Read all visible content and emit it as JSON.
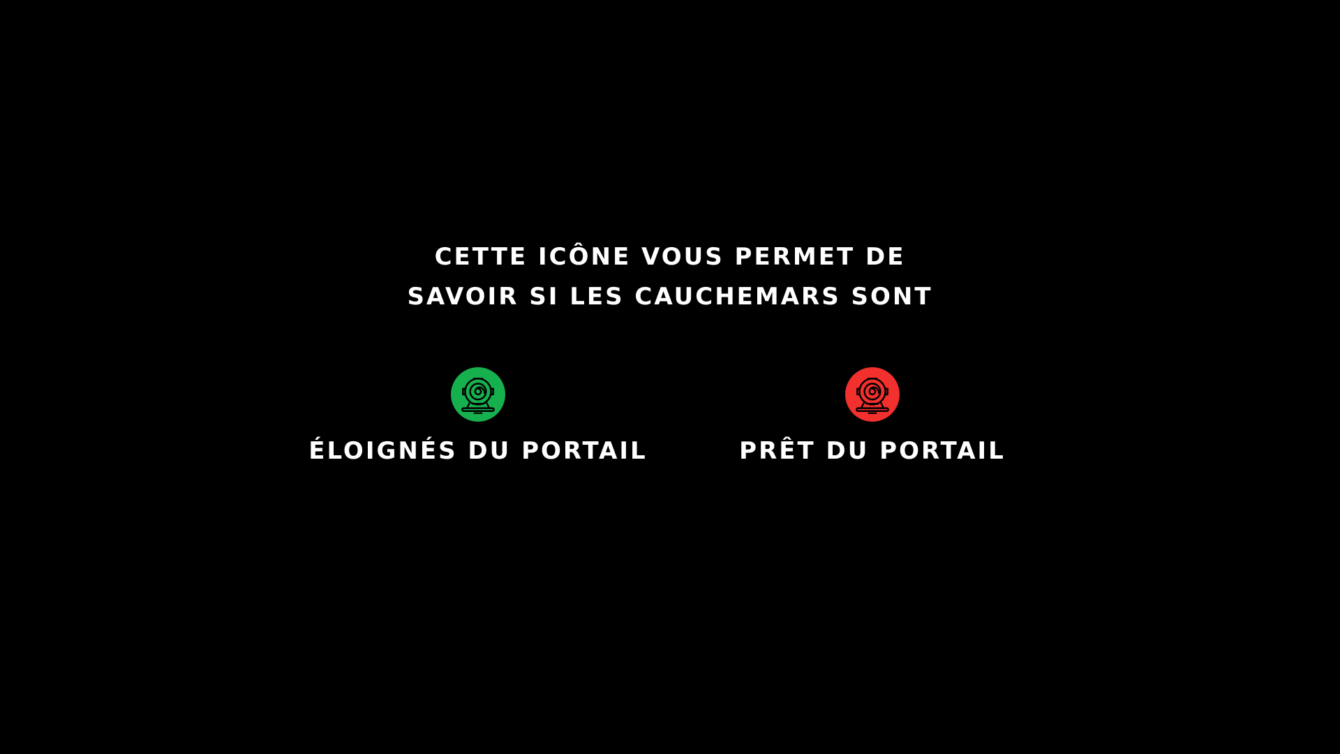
{
  "message": {
    "lines": [
      "CETTE ICÔNE VOUS PERMET DE",
      "SAVOIR SI LES CAUCHEMARS SONT"
    ]
  },
  "states": [
    {
      "label": "ÉLOIGNÉS DU PORTAIL",
      "color": "#17b04f",
      "icon": "portal-icon"
    },
    {
      "label": "PRÊT DU PORTAIL",
      "color": "#f2302e",
      "icon": "portal-icon"
    }
  ],
  "colors": {
    "background": "#000000",
    "text": "#ffffff",
    "icon_line": "#000000"
  }
}
